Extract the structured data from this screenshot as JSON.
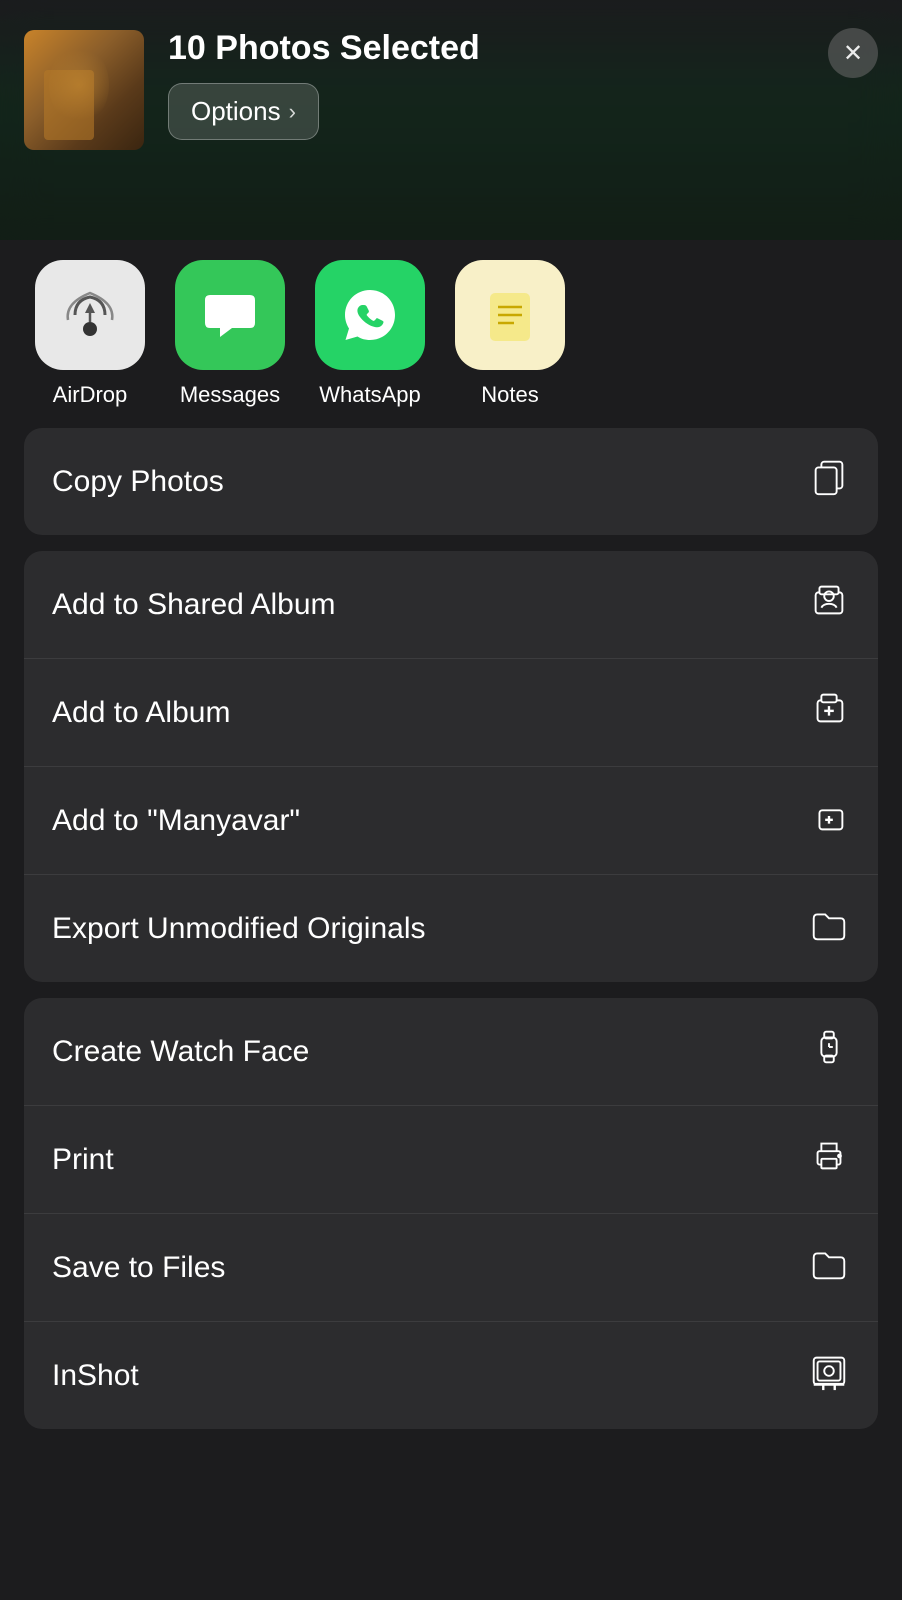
{
  "header": {
    "title": "10 Photos Selected",
    "options_label": "Options",
    "close_label": "✕"
  },
  "share_row": {
    "items": [
      {
        "id": "airdrop",
        "label": "AirDrop",
        "icon": "📡",
        "bg": "airdrop"
      },
      {
        "id": "messages",
        "label": "Messages",
        "icon": "💬",
        "bg": "messages"
      },
      {
        "id": "whatsapp",
        "label": "WhatsApp",
        "icon": "📱",
        "bg": "whatsapp"
      },
      {
        "id": "notes",
        "label": "Notes",
        "icon": "📝",
        "bg": "notes"
      }
    ]
  },
  "action_groups": [
    {
      "id": "group1",
      "items": [
        {
          "id": "copy_photos",
          "label": "Copy Photos",
          "icon": "copy"
        }
      ]
    },
    {
      "id": "group2",
      "items": [
        {
          "id": "add_shared_album",
          "label": "Add to Shared Album",
          "icon": "shared_album"
        },
        {
          "id": "add_album",
          "label": "Add to Album",
          "icon": "add_album"
        },
        {
          "id": "add_manyavar",
          "label": "Add to “Manyavar”",
          "icon": "add_to_album2"
        },
        {
          "id": "export_unmodified",
          "label": "Export Unmodified Originals",
          "icon": "folder"
        }
      ]
    },
    {
      "id": "group3",
      "items": [
        {
          "id": "create_watch_face",
          "label": "Create Watch Face",
          "icon": "watch"
        },
        {
          "id": "print",
          "label": "Print",
          "icon": "printer"
        },
        {
          "id": "save_to_files",
          "label": "Save to Files",
          "icon": "files_folder"
        },
        {
          "id": "inshot",
          "label": "InShot",
          "icon": "camera_frame"
        }
      ]
    }
  ]
}
